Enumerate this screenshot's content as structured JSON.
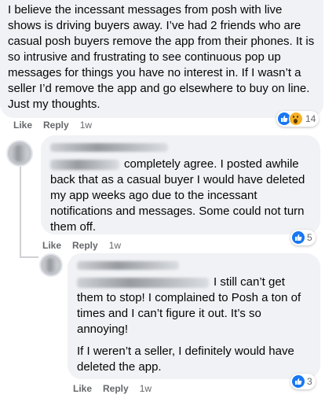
{
  "comment1": {
    "text": "I believe the incessant messages from posh with live shows is driving buyers away. I’ve had 2 friends who are casual posh buyers remove the app from their phones. It is so intrusive and frustrating to see continuous pop up messages for things you have no interest in. If I wasn’t a seller I’d remove the app and go elsewhere to buy on line. Just my thoughts.",
    "like_label": "Like",
    "reply_label": "Reply",
    "time": "1w",
    "reaction_count": "14",
    "reaction_icons": [
      "like-icon",
      "wow-icon"
    ]
  },
  "comment2": {
    "text_line1": "completely agree. I posted awhile",
    "text_rest": "back that as a casual buyer I would have deleted my app weeks ago due to the incessant notifications and messages. Some could not turn them off.",
    "like_label": "Like",
    "reply_label": "Reply",
    "time": "1w",
    "reaction_count": "5",
    "reaction_icons": [
      "like-icon"
    ]
  },
  "comment3": {
    "text_line1": "I still can’t get",
    "text_para1_rest": "them to stop! I complained to Posh a ton of times and I can’t figure it out. It’s so annoying!",
    "text_para2": "If I weren’t a seller, I definitely would have deleted the app.",
    "like_label": "Like",
    "reply_label": "Reply",
    "time": "1w",
    "reaction_count": "3",
    "reaction_icons": [
      "like-icon"
    ]
  },
  "colors": {
    "bubble": "#f0f2f5",
    "like_blue": "#1877f2",
    "meta_gray": "#65676b"
  }
}
